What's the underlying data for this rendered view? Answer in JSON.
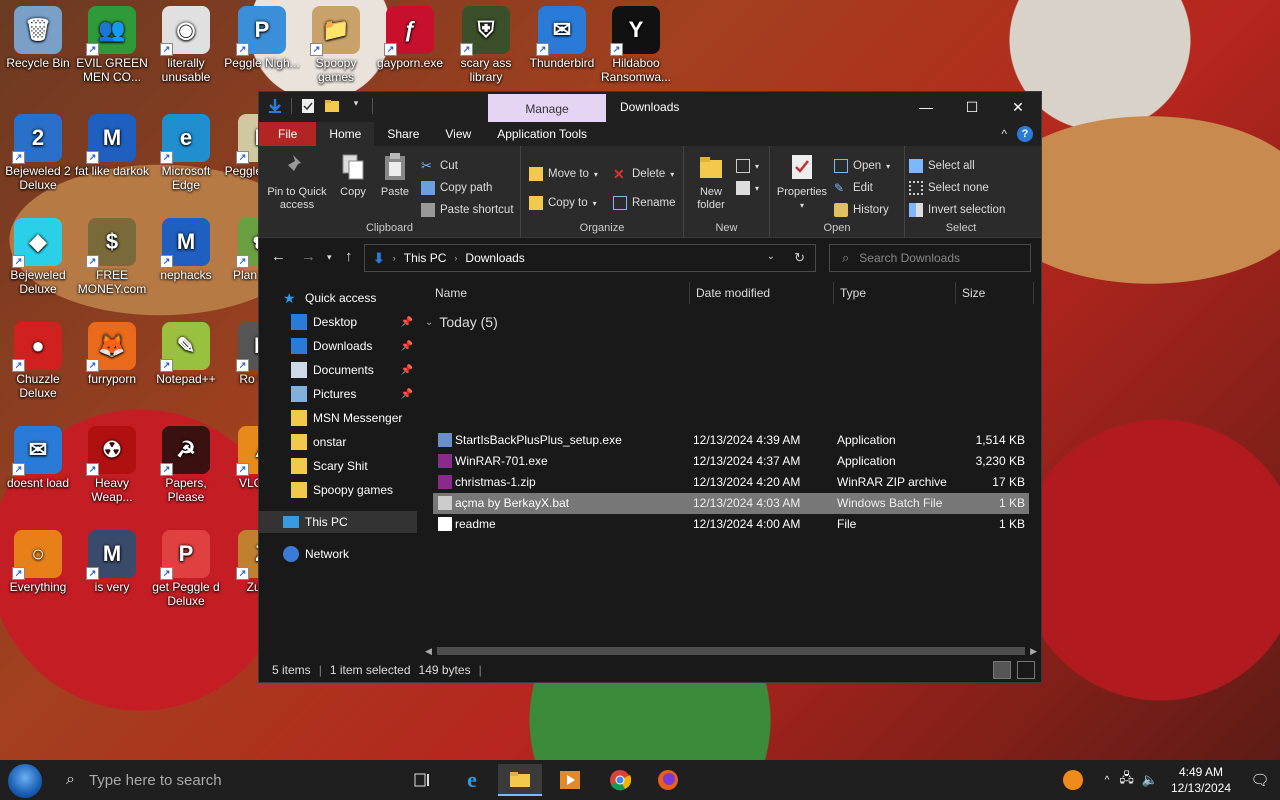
{
  "desktop": {
    "icons": [
      {
        "label": "Recycle Bin",
        "color": "#7aa0c8",
        "glyph": "🗑"
      },
      {
        "label": "EVIL GREEN MEN CO...",
        "color": "#2e9a3a",
        "glyph": "👥"
      },
      {
        "label": "literally unusable",
        "color": "#e0e0e0",
        "glyph": "◉"
      },
      {
        "label": "Peggle Nigh...",
        "color": "#3a8fd8",
        "glyph": "P"
      },
      {
        "label": "Spoopy games",
        "color": "#c9a26b",
        "glyph": "📁"
      },
      {
        "label": "gayporn.exe",
        "color": "#c8102e",
        "glyph": "ƒ"
      },
      {
        "label": "scary ass library",
        "color": "#3a4f2a",
        "glyph": "⛨"
      },
      {
        "label": "Thunderbird",
        "color": "#2a7bd8",
        "glyph": "✉"
      },
      {
        "label": "Hildaboo Ransomwa...",
        "color": "#111111",
        "glyph": "Y"
      },
      {
        "label": "Bejeweled 2 Deluxe",
        "color": "#2a6fc9",
        "glyph": "2"
      },
      {
        "label": "fat like darkok",
        "color": "#1f5fbf",
        "glyph": "M"
      },
      {
        "label": "Microsoft Edge",
        "color": "#1f8fd0",
        "glyph": "e"
      },
      {
        "label": "Peggle of W...",
        "color": "#d0c8a0",
        "glyph": "P"
      },
      {
        "label": "Bejeweled Deluxe",
        "color": "#2ad0e8",
        "glyph": "◆"
      },
      {
        "label": "FREE MONEY.com",
        "color": "#7a6a3a",
        "glyph": "$"
      },
      {
        "label": "nephacks",
        "color": "#1f5fbf",
        "glyph": "M"
      },
      {
        "label": "Plan Zon...",
        "color": "#6aa040",
        "glyph": "✿"
      },
      {
        "label": "Chuzzle Deluxe",
        "color": "#d02020",
        "glyph": "●"
      },
      {
        "label": "furryporn",
        "color": "#e86a1a",
        "glyph": "🦊"
      },
      {
        "label": "Notepad++",
        "color": "#9ac040",
        "glyph": "✎"
      },
      {
        "label": "Ro Ma...",
        "color": "#555555",
        "glyph": "R"
      },
      {
        "label": "doesnt load",
        "color": "#2a7bd8",
        "glyph": "✉"
      },
      {
        "label": "Heavy Weap...",
        "color": "#b01010",
        "glyph": "☢"
      },
      {
        "label": "Papers, Please",
        "color": "#3a1010",
        "glyph": "☭"
      },
      {
        "label": "VLC pl...",
        "color": "#e88a1a",
        "glyph": "▲"
      },
      {
        "label": "Everything",
        "color": "#e8801a",
        "glyph": "○"
      },
      {
        "label": "is very",
        "color": "#3a4a6a",
        "glyph": "M"
      },
      {
        "label": "get Peggle d Deluxe",
        "color": "#e04040",
        "glyph": "P"
      },
      {
        "label": "Zuma",
        "color": "#c08030",
        "glyph": "Z"
      }
    ]
  },
  "window": {
    "title": "Downloads",
    "manage_tab": "Manage",
    "tabs": [
      "File",
      "Home",
      "Share",
      "View",
      "Application Tools"
    ],
    "min_glyph": "—",
    "max_glyph": "☐",
    "close_glyph": "✕",
    "collapse_glyph": "^",
    "help_glyph": "?"
  },
  "ribbon": {
    "clipboard": {
      "pin": "Pin to Quick access",
      "copy": "Copy",
      "paste": "Paste",
      "cut": "Cut",
      "copy_path": "Copy path",
      "paste_shortcut": "Paste shortcut",
      "label": "Clipboard"
    },
    "organize": {
      "move_to": "Move to",
      "copy_to": "Copy to",
      "delete": "Delete",
      "rename": "Rename",
      "label": "Organize"
    },
    "new": {
      "new_folder": "New folder",
      "label": "New"
    },
    "open": {
      "properties": "Properties",
      "open": "Open",
      "edit": "Edit",
      "history": "History",
      "label": "Open"
    },
    "select": {
      "select_all": "Select all",
      "select_none": "Select none",
      "invert": "Invert selection",
      "label": "Select"
    }
  },
  "address": {
    "crumbs": [
      "This PC",
      "Downloads"
    ],
    "search_placeholder": "Search Downloads"
  },
  "nav": {
    "quick_access": "Quick access",
    "items": [
      {
        "label": "Desktop",
        "pinned": true
      },
      {
        "label": "Downloads",
        "pinned": true
      },
      {
        "label": "Documents",
        "pinned": true
      },
      {
        "label": "Pictures",
        "pinned": true
      },
      {
        "label": "MSN Messenger",
        "pinned": false
      },
      {
        "label": "onstar",
        "pinned": false
      },
      {
        "label": "Scary Shit",
        "pinned": false
      },
      {
        "label": "Spoopy games",
        "pinned": false
      }
    ],
    "this_pc": "This PC",
    "network": "Network"
  },
  "files": {
    "columns": [
      "Name",
      "Date modified",
      "Type",
      "Size"
    ],
    "group": "Today (5)",
    "rows": [
      {
        "name": "StartIsBackPlusPlus_setup.exe",
        "date": "12/13/2024 4:39 AM",
        "type": "Application",
        "size": "1,514 KB",
        "selected": false
      },
      {
        "name": "WinRAR-701.exe",
        "date": "12/13/2024 4:37 AM",
        "type": "Application",
        "size": "3,230 KB",
        "selected": false
      },
      {
        "name": "christmas-1.zip",
        "date": "12/13/2024 4:20 AM",
        "type": "WinRAR ZIP archive",
        "size": "17 KB",
        "selected": false
      },
      {
        "name": "açma by BerkayX.bat",
        "date": "12/13/2024 4:03 AM",
        "type": "Windows Batch File",
        "size": "1 KB",
        "selected": true
      },
      {
        "name": "readme",
        "date": "12/13/2024 4:00 AM",
        "type": "File",
        "size": "1 KB",
        "selected": false
      }
    ]
  },
  "status": {
    "items": "5 items",
    "selected": "1 item selected",
    "bytes": "149 bytes"
  },
  "taskbar": {
    "search_placeholder": "Type here to search",
    "time": "4:49 AM",
    "date": "12/13/2024"
  },
  "colors": {
    "accent_file_tab": "#b32525",
    "manage_tab": "#e6d4f5",
    "folder_yellow": "#f2c94c",
    "nav_blue": "#2a7bd8"
  }
}
